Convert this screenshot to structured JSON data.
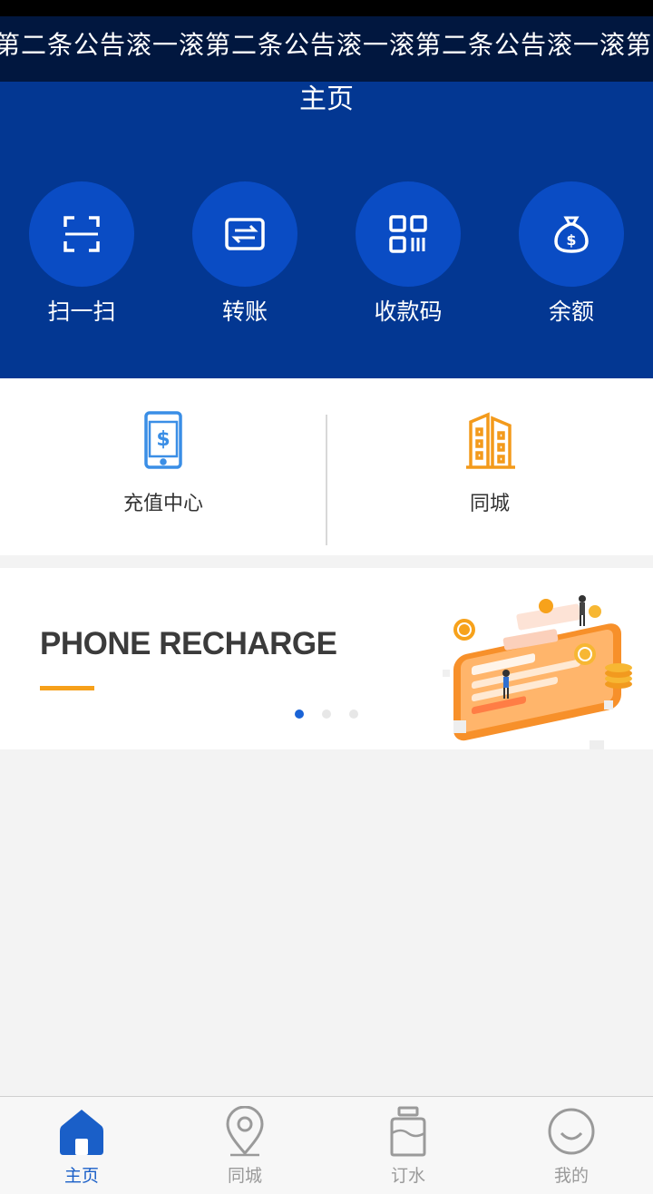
{
  "announcement": {
    "text": "第二条公告滚一滚第二条公告滚一滚第二条公告滚一滚第二条公告滚一滚"
  },
  "header": {
    "title": "主页"
  },
  "quick_actions": [
    {
      "label": "扫一扫",
      "icon": "scan-icon"
    },
    {
      "label": "转账",
      "icon": "transfer-icon"
    },
    {
      "label": "收款码",
      "icon": "qr-code-icon"
    },
    {
      "label": "余额",
      "icon": "money-bag-icon"
    }
  ],
  "services": [
    {
      "label": "充值中心",
      "icon": "phone-recharge-icon",
      "color": "#3a8ee6"
    },
    {
      "label": "同城",
      "icon": "buildings-icon",
      "color": "#f39a1b"
    }
  ],
  "banner": {
    "title": "PHONE RECHARGE",
    "accent": "#f6a01a",
    "slides_total": 3,
    "active_slide": 1
  },
  "tabbar": {
    "active_color": "#1a5fc8",
    "inactive_color": "#9a9a9a",
    "items": [
      {
        "label": "主页",
        "icon": "home-icon",
        "active": true
      },
      {
        "label": "同城",
        "icon": "location-pin-icon",
        "active": false
      },
      {
        "label": "订水",
        "icon": "water-bottle-icon",
        "active": false
      },
      {
        "label": "我的",
        "icon": "smiley-face-icon",
        "active": false
      }
    ]
  },
  "colors": {
    "header_bg": "#033792",
    "marquee_bg": "#01173f",
    "circle_bg": "#0a4cc4",
    "page_bg": "#f3f3f3"
  }
}
